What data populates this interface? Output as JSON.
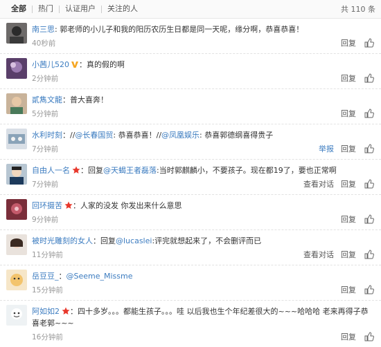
{
  "filters": {
    "all": "全部",
    "hot": "热门",
    "verified": "认证用户",
    "following": "关注的人",
    "total": "共 110 条"
  },
  "labels": {
    "reply": "回复",
    "report": "举报",
    "view_thread": "查看对话"
  },
  "colors": {
    "link": "#3c7cc0",
    "time": "#999999",
    "star": "#e8382c",
    "vbadge": "#f5a623"
  },
  "comments": [
    {
      "user": "南三思",
      "parts": [
        ": 郭老师的小儿子和我的阳历农历生日都是同一天呢，缘分啊，恭喜恭喜！"
      ],
      "time": "40秒前",
      "badge": ""
    },
    {
      "user": "小茜儿520",
      "parts": [
        "：真的假的啊"
      ],
      "time": "2分钟前",
      "badge": "v"
    },
    {
      "user": "貳雋文龍",
      "parts": [
        "：普大喜奔！"
      ],
      "time": "5分钟前",
      "badge": ""
    },
    {
      "user": "水利时刻",
      "parts": [
        "：//",
        "@长春国贸",
        ": 恭喜恭喜！//",
        "@凤凰娱乐",
        ": 恭喜郭德纲喜得贵子"
      ],
      "time": "7分钟前",
      "badge": ""
    },
    {
      "user": "自由人一名",
      "parts": [
        "：回复",
        "@天蝎王者磊落",
        ":当时郭麒麟小，不要孩子。现在都19了，要也正常啊"
      ],
      "time": "7分钟前",
      "badge": "star"
    },
    {
      "user": "回环摄苦",
      "parts": [
        "：人家的没发 你发出来什么意思"
      ],
      "time": "9分钟前",
      "badge": "star"
    },
    {
      "user": "被时光雕刻的女人",
      "parts": [
        "：回复",
        "@lucaslei",
        ":评完就想起来了，不会删评而已"
      ],
      "time": "11分钟前",
      "badge": ""
    },
    {
      "user": "岳豆豆_",
      "parts": [
        "：",
        "@Seeme_Missme"
      ],
      "time": "15分钟前",
      "badge": ""
    },
    {
      "user": "阿如如2",
      "parts": [
        "：四十多岁。。。都能生孩子。。。哇 以后我也生个年纪差很大的~~~哈哈哈 老来再得子恭喜老郭~~~"
      ],
      "time": "16分钟前",
      "badge": "star"
    }
  ]
}
